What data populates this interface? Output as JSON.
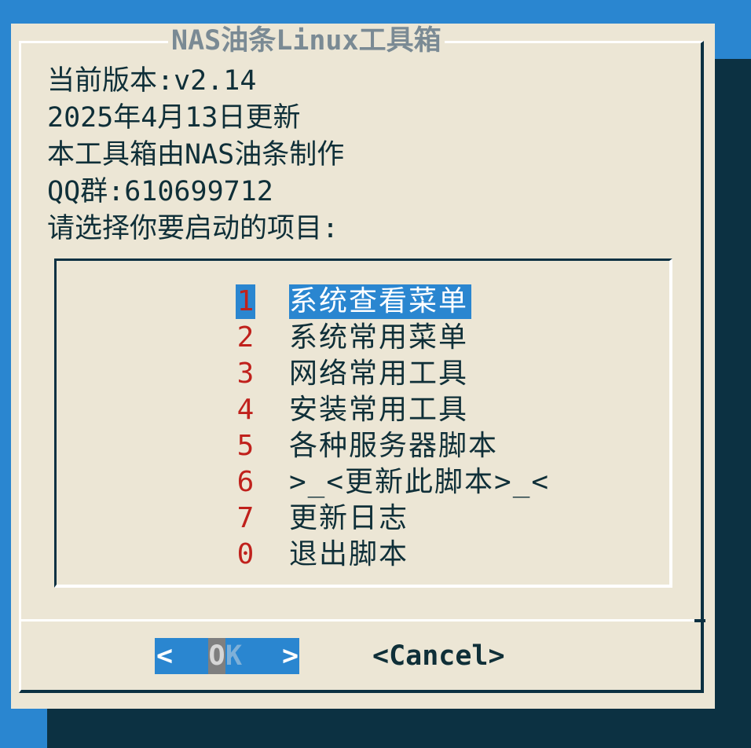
{
  "dialog": {
    "title": "NAS油条Linux工具箱",
    "info_lines": [
      "当前版本:v2.14",
      "2025年4月13日更新",
      "本工具箱由NAS油条制作",
      "QQ群:610699712",
      "请选择你要启动的项目:"
    ]
  },
  "menu": {
    "selected_index": 0,
    "items": [
      {
        "tag": "1",
        "label": "系统查看菜单"
      },
      {
        "tag": "2",
        "label": "系统常用菜单"
      },
      {
        "tag": "3",
        "label": "网络常用工具"
      },
      {
        "tag": "4",
        "label": "安装常用工具"
      },
      {
        "tag": "5",
        "label": "各种服务器脚本"
      },
      {
        "tag": "6",
        "label": ">_<更新此脚本>_<"
      },
      {
        "tag": "7",
        "label": "更新日志"
      },
      {
        "tag": "0",
        "label": "退出脚本"
      }
    ]
  },
  "buttons": {
    "ok": {
      "left": "<",
      "hotkey": "O",
      "rest": "K",
      "right": ">"
    },
    "cancel": "<Cancel>"
  },
  "colors": {
    "background": "#2a86d0",
    "dialog": "#ece6d5",
    "shadow": "#0c3142",
    "tag": "#c0211c",
    "text": "#0f2f38",
    "title": "#7a8a94",
    "selection": "#2a86d0"
  }
}
